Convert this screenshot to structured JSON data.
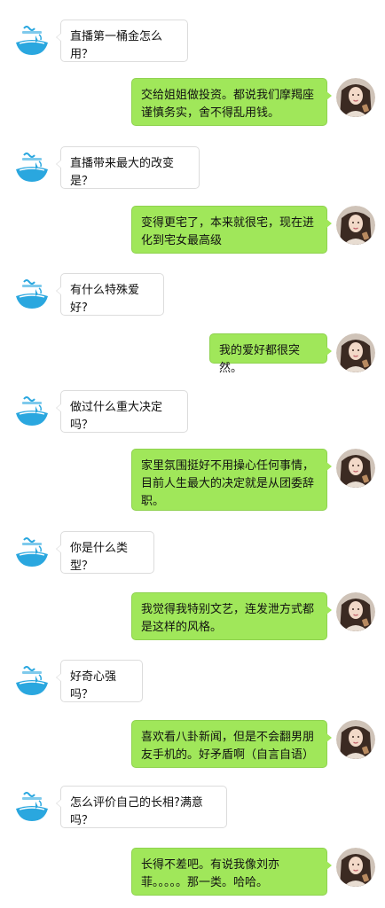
{
  "colors": {
    "background": "#ffffff",
    "bot_bubble": "#ffffff",
    "bot_bubble_border": "#dcdcdc",
    "user_bubble": "#a0e75a",
    "logo_blue": "#2aa7df"
  },
  "icons": {
    "bot_avatar": "water-drop-logo-icon",
    "user_avatar": "user-photo-avatar"
  },
  "messages": [
    {
      "side": "left",
      "text": "直播第一桶金怎么用？"
    },
    {
      "side": "right",
      "text": "交给姐姐做投资。都说我们摩羯座谨慎务实，舍不得乱用钱。"
    },
    {
      "side": "left",
      "text": "直播带来最大的改变是？"
    },
    {
      "side": "right",
      "text": "变得更宅了，本来就很宅，现在进化到宅女最高级"
    },
    {
      "side": "left",
      "text": "有什么特殊爱好?"
    },
    {
      "side": "right",
      "text": "我的爱好都很突然。"
    },
    {
      "side": "left",
      "text": "做过什么重大决定吗？"
    },
    {
      "side": "right",
      "text": "家里氛围挺好不用操心任何事情，目前人生最大的决定就是从团委辞职。"
    },
    {
      "side": "left",
      "text": "你是什么类型？"
    },
    {
      "side": "right",
      "text": "我觉得我特别文艺，连发泄方式都是这样的风格。"
    },
    {
      "side": "left",
      "text": "好奇心强吗？"
    },
    {
      "side": "right",
      "text": "喜欢看八卦新闻，但是不会翻男朋友手机的。好矛盾啊（自言自语）"
    },
    {
      "side": "left",
      "text": "怎么评价自己的长相?满意吗？"
    },
    {
      "side": "right",
      "text": "长得不差吧。有说我像刘亦菲。。。。。那一类。哈哈。"
    }
  ]
}
